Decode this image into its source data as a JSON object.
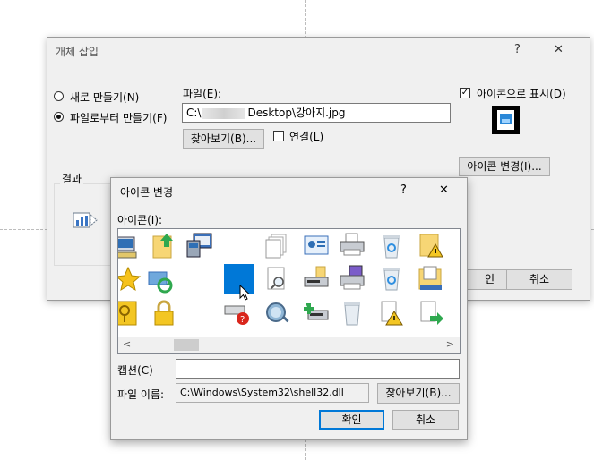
{
  "outer_dialog": {
    "title": "개체 삽입",
    "help": "?",
    "close": "✕",
    "radio_new": "새로 만들기(N)",
    "radio_from_file": "파일로부터 만들기(F)",
    "file_label": "파일(E):",
    "file_path_prefix": "C:\\",
    "file_path_suffix": "Desktop\\강아지.jpg",
    "browse_button": "찾아보기(B)...",
    "link_label": "연결(L)",
    "display_as_icon_label": "아이콘으로 표시(D)",
    "change_icon_button": "아이콘 변경(I)...",
    "result_label": "결과",
    "ok_button": "인",
    "cancel_button": "취소"
  },
  "inner_dialog": {
    "title": "아이콘 변경",
    "help": "?",
    "close": "✕",
    "icons_label": "아이콘(I):",
    "caption_label": "캡션(C)",
    "caption_value": "",
    "filename_label": "파일 이름:",
    "filename_value": "C:\\Windows\\System32\\shell32.dll",
    "browse_button": "찾아보기(B)...",
    "ok_button": "확인",
    "cancel_button": "취소",
    "scroll_left": "<",
    "scroll_right": ">"
  },
  "colors": {
    "accent": "#0078d7",
    "dialog_bg": "#f0f0f0",
    "selected_icon": "#0078d7"
  }
}
